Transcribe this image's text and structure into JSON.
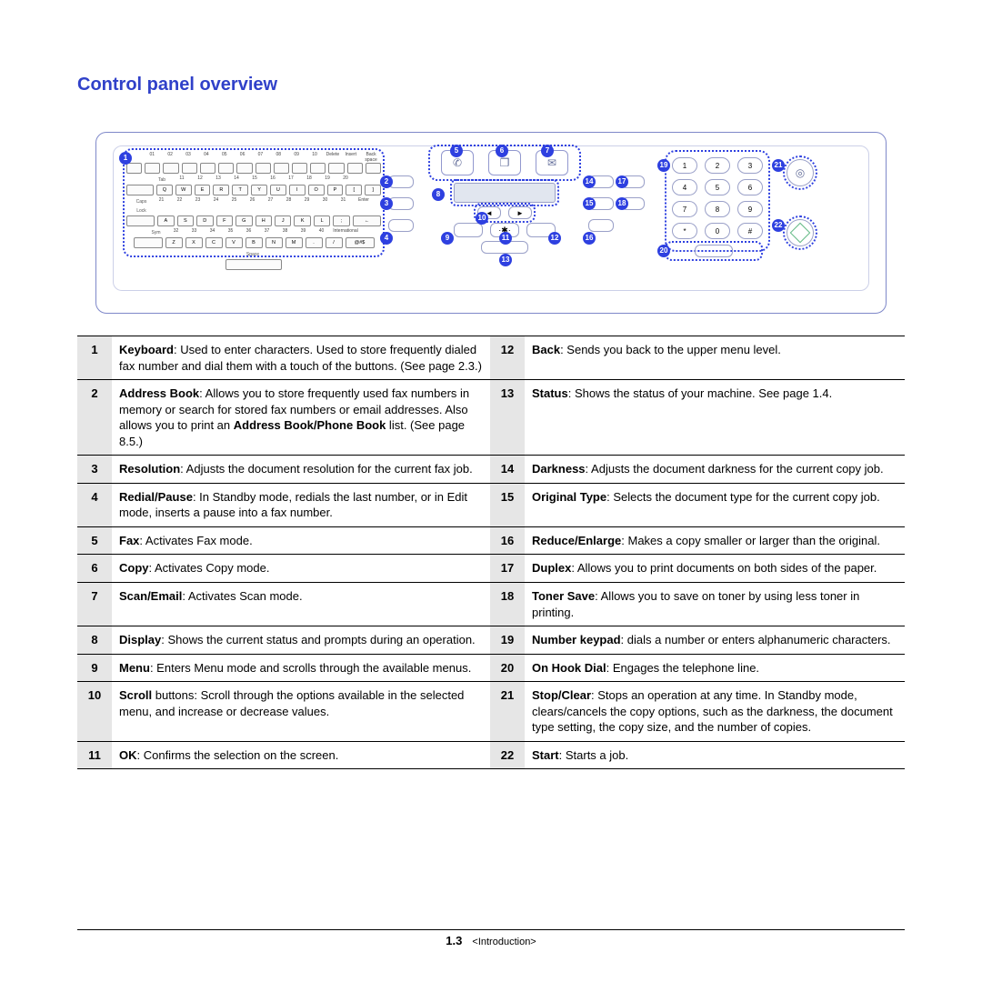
{
  "heading": "Control panel overview",
  "footer": {
    "page_chapter": "1",
    "page_sep": ".",
    "page_num": "3",
    "section": "<Introduction>"
  },
  "callouts": {
    "c1": "1",
    "c2": "2",
    "c3": "3",
    "c4": "4",
    "c5": "5",
    "c6": "6",
    "c7": "7",
    "c8": "8",
    "c9": "9",
    "c10": "10",
    "c11": "11",
    "c12": "12",
    "c13": "13",
    "c14": "14",
    "c15": "15",
    "c16": "16",
    "c17": "17",
    "c18": "18",
    "c19": "19",
    "c20": "20",
    "c21": "21",
    "c22": "22"
  },
  "keyboard": {
    "row1nums": [
      "01",
      "02",
      "03",
      "04",
      "05",
      "06",
      "07",
      "08",
      "09",
      "10"
    ],
    "row1extras": [
      "Delete",
      "Insert",
      "Back space"
    ],
    "row2nums": [
      "11",
      "12",
      "13",
      "14",
      "15",
      "16",
      "17",
      "18",
      "19",
      "20"
    ],
    "row2keys": [
      "Q",
      "W",
      "E",
      "R",
      "T",
      "Y",
      "U",
      "I",
      "O",
      "P",
      "[",
      "]"
    ],
    "row3nums": [
      "21",
      "22",
      "23",
      "24",
      "25",
      "26",
      "27",
      "28",
      "29",
      "30",
      "31"
    ],
    "row3keys": [
      "A",
      "S",
      "D",
      "F",
      "G",
      "H",
      "J",
      "K",
      "L",
      ";",
      "←"
    ],
    "row4nums": [
      "32",
      "33",
      "34",
      "35",
      "36",
      "37",
      "38",
      "39",
      "40"
    ],
    "row4keys": [
      "Z",
      "X",
      "C",
      "V",
      "B",
      "N",
      "M",
      ".",
      "/",
      "@#$"
    ],
    "labels": {
      "tab": "Tab",
      "caps": "Caps Lock",
      "sym": "Sym",
      "space": "Space",
      "enter": "Enter",
      "intl": "International"
    }
  },
  "keypad": {
    "rows": [
      [
        "1",
        "2",
        "3"
      ],
      [
        "4",
        "5",
        "6"
      ],
      [
        "7",
        "8",
        "9"
      ],
      [
        "*",
        "0",
        "#"
      ]
    ]
  },
  "center_pills": [
    "◄",
    "·✱·",
    "►"
  ],
  "table": {
    "rows": [
      {
        "n": "1",
        "term": "Keyboard",
        "desc": ": Used to enter characters. Used to store frequently dialed fax number and dial them with a touch of the buttons. (See page 2.3.)",
        "n2": "12",
        "term2": "Back",
        "desc2": ": Sends you back to the upper menu level."
      },
      {
        "n": "2",
        "term": "Address Book",
        "desc": ": Allows you to store frequently used fax numbers in memory or search for stored fax numbers or email addresses. Also allows you to print an ",
        "bold_extra": "Address Book/Phone Book",
        "desc_tail": " list. (See page 8.5.)",
        "n2": "13",
        "term2": "Status",
        "desc2": ": Shows the status of your machine. See page 1.4."
      },
      {
        "n": "3",
        "term": "Resolution",
        "desc": ": Adjusts the document resolution for the current fax job.",
        "n2": "14",
        "term2": "Darkness",
        "desc2": ": Adjusts the document darkness for the current copy job."
      },
      {
        "n": "4",
        "term": "Redial/Pause",
        "desc": ": In Standby mode, redials the last number, or in Edit mode, inserts a pause into a fax number.",
        "n2": "15",
        "term2": "Original Type",
        "desc2": ": Selects the document type for the current copy job."
      },
      {
        "n": "5",
        "term": "Fax",
        "desc": ": Activates Fax mode.",
        "n2": "16",
        "term2": "Reduce/Enlarge",
        "desc2": ": Makes a copy smaller or larger than the original."
      },
      {
        "n": "6",
        "term": "Copy",
        "desc": ": Activates Copy mode.",
        "n2": "17",
        "term2": "Duplex",
        "desc2": ": Allows you to print documents on both sides of the paper."
      },
      {
        "n": "7",
        "term": "Scan/Email",
        "desc": ": Activates Scan mode.",
        "n2": "18",
        "term2": "Toner Save",
        "desc2": ": Allows you to save on toner by using less toner in printing."
      },
      {
        "n": "8",
        "term": "Display",
        "desc": ": Shows the current status and prompts during an operation.",
        "n2": "19",
        "term2": "Number keypad",
        "desc2": ": dials a number or enters alphanumeric characters."
      },
      {
        "n": "9",
        "term": "Menu",
        "desc": ": Enters Menu mode and scrolls through the available menus.",
        "n2": "20",
        "term2": "On Hook Dial",
        "desc2": ": Engages the telephone line."
      },
      {
        "n": "10",
        "term": "Scroll",
        "desc": " buttons: Scroll through the options available in the selected menu, and increase or decrease values.",
        "n2": "21",
        "term2": "Stop/Clear",
        "desc2": ": Stops an operation at any time. In Standby mode, clears/cancels the copy options, such as the darkness, the document type setting, the copy size, and the number of copies."
      },
      {
        "n": "11",
        "term": "OK",
        "desc": ": Confirms the selection on the screen.",
        "n2": "22",
        "term2": "Start",
        "desc2": ": Starts a job."
      }
    ]
  }
}
